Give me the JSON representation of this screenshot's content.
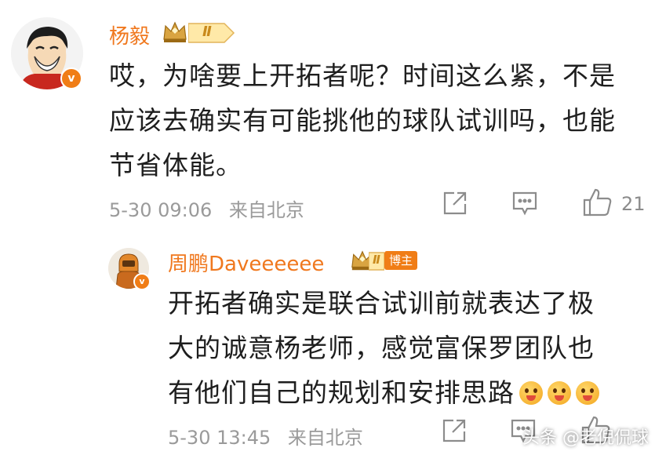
{
  "comment": {
    "author": "杨毅",
    "level_badge": "Ⅱ",
    "text_lines": [
      "哎，为啥要上开拓者呢？时间这么紧，不是",
      "应该去确实有可能挑他的球队试训吗，也能",
      "节省体能。"
    ],
    "timestamp": "5-30 09:06",
    "location": "来自北京",
    "like_count": "21",
    "verified_mark": "v"
  },
  "reply": {
    "author": "周鹏Daveeeeee",
    "level_badge": "Ⅱ",
    "blogger_tag": "博主",
    "text_lines": [
      "开拓者确实是联合试训前就表达了极",
      "大的诚意杨老师，感觉富保罗团队也",
      "有他们自己的规划和安排思路"
    ],
    "timestamp": "5-30 13:45",
    "location": "来自北京",
    "verified_mark": "v"
  },
  "watermark": "头条 @老倪侃球",
  "colors": {
    "name": "#f0781e",
    "meta": "#9a9a9a",
    "verified": "#f07d16"
  }
}
